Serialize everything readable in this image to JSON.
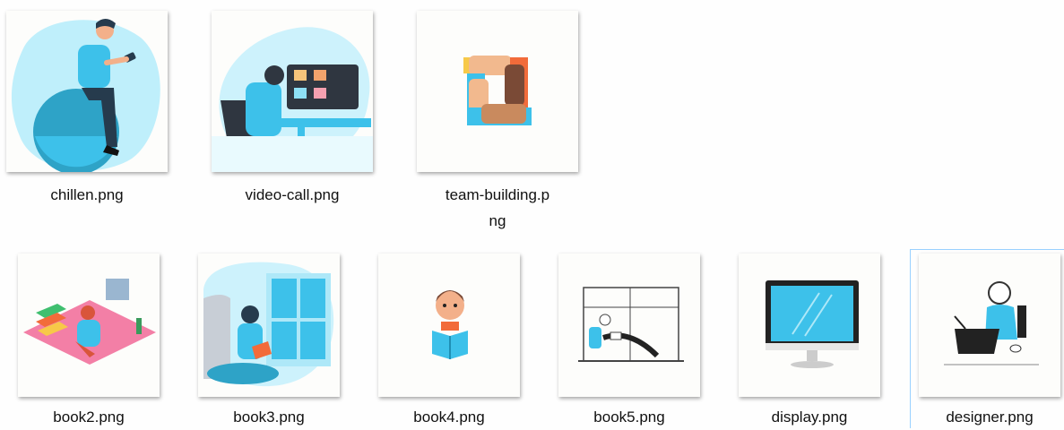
{
  "files": [
    {
      "name": "chillen.png",
      "icon": "chillen-thumbnail",
      "label_line1": "chillen.png",
      "label_line2": ""
    },
    {
      "name": "video-call.png",
      "icon": "video-call-thumbnail",
      "label_line1": "video-call.png",
      "label_line2": ""
    },
    {
      "name": "team-building.png",
      "icon": "team-building-thumbnail",
      "label_line1": "team-building.p",
      "label_line2": "ng"
    },
    {
      "name": "book2.png",
      "icon": "book2-thumbnail",
      "label_line1": "book2.png",
      "label_line2": ""
    },
    {
      "name": "book3.png",
      "icon": "book3-thumbnail",
      "label_line1": "book3.png",
      "label_line2": ""
    },
    {
      "name": "book4.png",
      "icon": "book4-thumbnail",
      "label_line1": "book4.png",
      "label_line2": ""
    },
    {
      "name": "book5.png",
      "icon": "book5-thumbnail",
      "label_line1": "book5.png",
      "label_line2": ""
    },
    {
      "name": "display.png",
      "icon": "display-thumbnail",
      "label_line1": "display.png",
      "label_line2": ""
    },
    {
      "name": "designer.png",
      "icon": "designer-thumbnail",
      "label_line1": "designer.png",
      "label_line2": ""
    }
  ],
  "colors": {
    "accent_blue": "#3dc1ea",
    "dark_blue": "#1f8fb5",
    "selection_border": "#99d1ff"
  }
}
